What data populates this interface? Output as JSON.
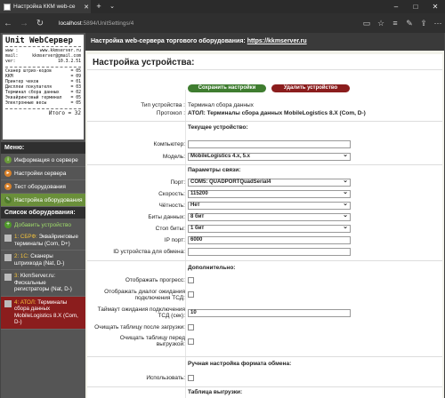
{
  "browser": {
    "tab_title": "Настройка ККМ web-се",
    "address_host": "localhost",
    "address_rest": ":5894/UnitSettings/4"
  },
  "receipt": {
    "logo": "Unit WebСервер",
    "lines": [
      [
        "www :",
        "www.kkmserver.ru"
      ],
      [
        "mail:",
        "kkmserver@gmail.com"
      ],
      [
        "ver:",
        "10.3.2.51"
      ]
    ],
    "stats": [
      [
        "Сканер штрих-кодов",
        "= 05"
      ],
      [
        "ККМ",
        "= 09"
      ],
      [
        "Принтер чеков",
        "= 01"
      ],
      [
        "Дисплеи покупателя",
        "= 03"
      ],
      [
        "Терминал сбора данных",
        "= 02"
      ],
      [
        "Эквайринговый терминал",
        "= 05"
      ],
      [
        "Электронные весы",
        "= 05"
      ]
    ],
    "total": "Итого = 32"
  },
  "menu": {
    "title": "Меню:",
    "items": [
      {
        "label": "Информация о сервере",
        "color": "#6a9a3a"
      },
      {
        "label": "Настройки сервера",
        "color": "#d9822b"
      },
      {
        "label": "Тест оборудования",
        "color": "#d9822b"
      },
      {
        "label": "Настройка оборудования",
        "color": "#6a9a3a"
      }
    ]
  },
  "devices": {
    "title": "Список оборудования:",
    "add_label": "Добавить устройство",
    "items": [
      {
        "num": "1: СБРФ:",
        "text": "Эквайринговые терминалы (Com, D+)"
      },
      {
        "num": "2: 1С:",
        "text": "Сканеры штрихкода (Nat, D-)"
      },
      {
        "num": "3:",
        "text": "KkmServer.ru: Фискальные регистраторы (Nat, D-)"
      },
      {
        "num": "4: АТОЛ:",
        "text": "Терминалы сбора данных MobileLogistics 8.X (Com, D-)"
      }
    ]
  },
  "header": {
    "text": "Настройка web-сервера торгового оборудования: ",
    "link": "https://kkmserver.ru"
  },
  "panel": {
    "title": "Настройка устройства:",
    "save_label": "Сохранить настройки",
    "delete_label": "Удалить устройство",
    "type_label": "Тип устройства :",
    "type_value": "Терминал сбора данных",
    "protocol_label": "Протокол :",
    "protocol_value": "АТОЛ: Терминалы сбора данных MobileLogistics 8.X (Com, D-)",
    "current_section": "Текущее устройство:",
    "computer_label": "Компьютер:",
    "computer_value": "",
    "model_label": "Модель:",
    "model_value": "MobileLogistics 4.x, 5.x",
    "link_section": "Параметры связи:",
    "port_label": "Порт:",
    "port_value": "COM5: QUADPORTQuadSerial4",
    "speed_label": "Скорость:",
    "speed_value": "115200",
    "parity_label": "Чётность:",
    "parity_value": "Нет",
    "databits_label": "Биты данных:",
    "databits_value": "8 бит",
    "stopbits_label": "Стоп биты:",
    "stopbits_value": "1 бит",
    "ipport_label": "IP порт:",
    "ipport_value": "6000",
    "exchangeid_label": "ID устройства для обмена:",
    "exchangeid_value": "",
    "extra_section": "Дополнительно:",
    "progress_label": "Отображать прогресс:",
    "waitdialog_label1": "Отображать диалог ожидания",
    "waitdialog_label2": "подключения ТСД:",
    "timeout_label1": "Таймаут ожидания подключения",
    "timeout_label2": "ТСД (сек):",
    "timeout_value": "10",
    "clear_after_label": "Очищать таблицу после загрузки:",
    "clear_before_label1": "Очищать таблицу перед",
    "clear_before_label2": "выгрузкой:",
    "manual_section": "Ручная настройка формата обмена:",
    "use_label": "Использовать:",
    "upload_table_label": "Таблица выгрузки:"
  }
}
